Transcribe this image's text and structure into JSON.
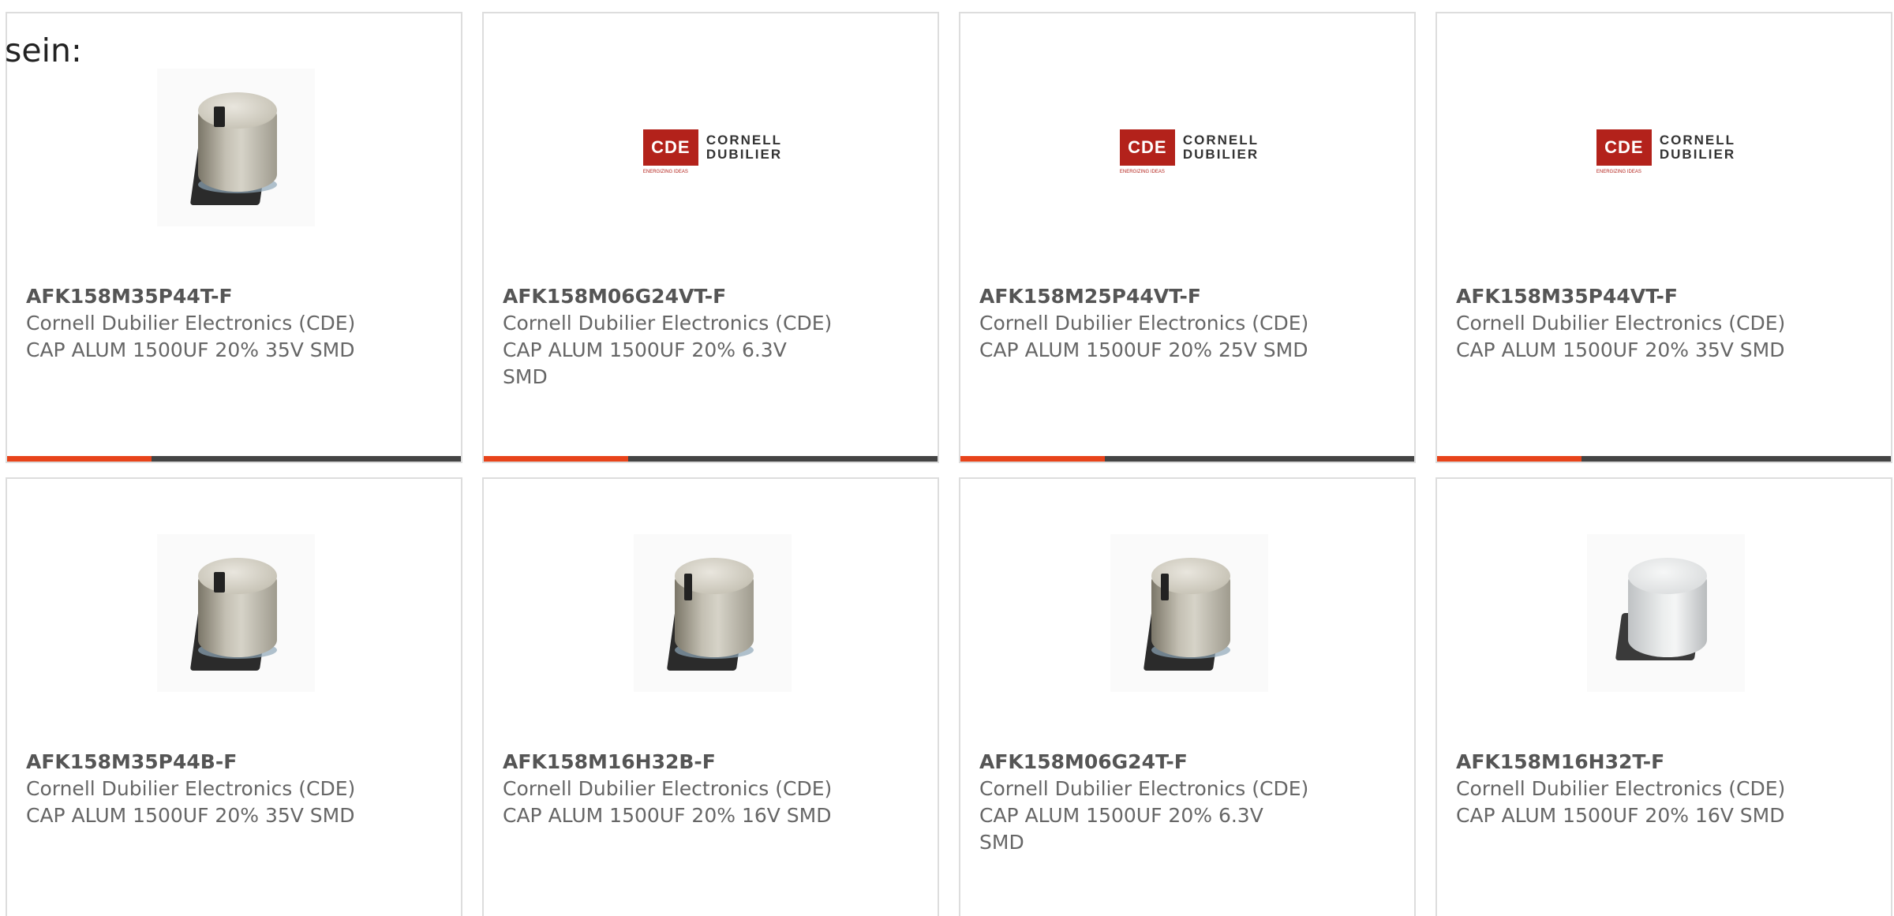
{
  "lead_text": "sein:",
  "logo": {
    "badge": "CDE",
    "tagline": "ENERGIZING IDEAS",
    "line1": "CORNELL",
    "line2": "DUBILIER"
  },
  "colors": {
    "accent": "#e8431a",
    "bar": "#444444",
    "border": "#dddddd",
    "text": "#666666",
    "logo_red": "#b3221b"
  },
  "products": [
    {
      "part": "AFK158M35P44T-F",
      "manufacturer": "Cornell Dubilier Electronics (CDE)",
      "description": "CAP ALUM 1500UF 20% 35V SMD",
      "image": "capacitor-photo"
    },
    {
      "part": "AFK158M06G24VT-F",
      "manufacturer": "Cornell Dubilier Electronics (CDE)",
      "description": "CAP ALUM 1500UF 20% 6.3V SMD",
      "image": "cde-logo"
    },
    {
      "part": "AFK158M25P44VT-F",
      "manufacturer": "Cornell Dubilier Electronics (CDE)",
      "description": "CAP ALUM 1500UF 20% 25V SMD",
      "image": "cde-logo"
    },
    {
      "part": "AFK158M35P44VT-F",
      "manufacturer": "Cornell Dubilier Electronics (CDE)",
      "description": "CAP ALUM 1500UF 20% 35V SMD",
      "image": "cde-logo"
    },
    {
      "part": "AFK158M35P44B-F",
      "manufacturer": "Cornell Dubilier Electronics (CDE)",
      "description": "CAP ALUM 1500UF 20% 35V SMD",
      "image": "capacitor-photo"
    },
    {
      "part": "AFK158M16H32B-F",
      "manufacturer": "Cornell Dubilier Electronics (CDE)",
      "description": "CAP ALUM 1500UF 20% 16V SMD",
      "image": "capacitor-photo"
    },
    {
      "part": "AFK158M06G24T-F",
      "manufacturer": "Cornell Dubilier Electronics (CDE)",
      "description": "CAP ALUM 1500UF 20% 6.3V SMD",
      "image": "capacitor-photo"
    },
    {
      "part": "AFK158M16H32T-F",
      "manufacturer": "Cornell Dubilier Electronics (CDE)",
      "description": "CAP ALUM 1500UF 20% 16V SMD",
      "image": "capacitor-photo-white"
    }
  ]
}
